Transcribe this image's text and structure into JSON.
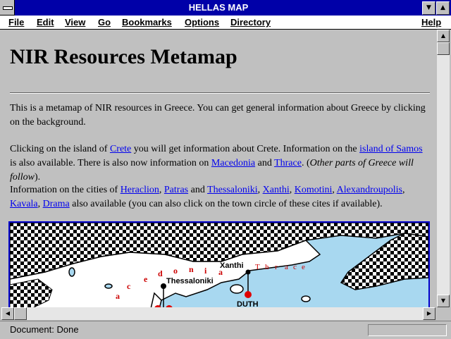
{
  "window": {
    "title": "HELLAS MAP"
  },
  "menu": {
    "file": "File",
    "edit": "Edit",
    "view": "View",
    "go": "Go",
    "bookmarks": "Bookmarks",
    "options": "Options",
    "directory": "Directory",
    "help": "Help"
  },
  "page": {
    "title": "NIR Resources Metamap",
    "p1": "This is a metamap of NIR resources in Greece. You can get general information about Greece by clicking on the background.",
    "p2": {
      "t1": "Clicking on the island of ",
      "crete": "Crete",
      "t2": " you will get information about Crete. Information on the ",
      "samos": "island of Samos",
      "t3": " is also available. There is also now information on ",
      "macedonia": "Macedonia",
      "t4": " and ",
      "thrace": "Thrace",
      "t5": ". (",
      "other": "Other parts of Greece will follow",
      "t6": ")."
    },
    "p3": {
      "t1": "Information on the cities of ",
      "heraclion": "Heraclion",
      "t2": ", ",
      "patras": "Patras",
      "t3": " and ",
      "thessaloniki": "Thessaloniki",
      "t4": ", ",
      "xanthi": "Xanthi",
      "t5": ", ",
      "komotini": "Komotini",
      "t6": ", ",
      "alexandroupolis": "Alexandroupolis",
      "t7": ", ",
      "kavala": "Kavala",
      "t8": ", ",
      "drama": "Drama",
      "t9": " also available (you can also click on the town circle of these cites if available)."
    }
  },
  "map": {
    "region_macedonia_letters": [
      "a",
      "c",
      "e",
      "d",
      "o",
      "n",
      "i",
      "a"
    ],
    "region_thrace_letters": [
      "T",
      "h",
      "r",
      "a",
      "c",
      "e"
    ],
    "city_thessaloniki": "Thessaloniki",
    "city_xanthi": "Xanthi",
    "duth": "DUTH",
    "colors": {
      "sea": "#a8d8f0",
      "land": "#ffffff",
      "grid": "#000000",
      "marker": "#e00000",
      "label": "#cc0000"
    }
  },
  "status": {
    "text": "Document: Done"
  },
  "icons": {
    "system_menu": "system-menu-icon",
    "minimize": "minimize-icon",
    "maximize": "maximize-icon",
    "scroll_up": "arrow-up-icon",
    "scroll_down": "arrow-down-icon",
    "scroll_left": "arrow-left-icon",
    "scroll_right": "arrow-right-icon"
  }
}
